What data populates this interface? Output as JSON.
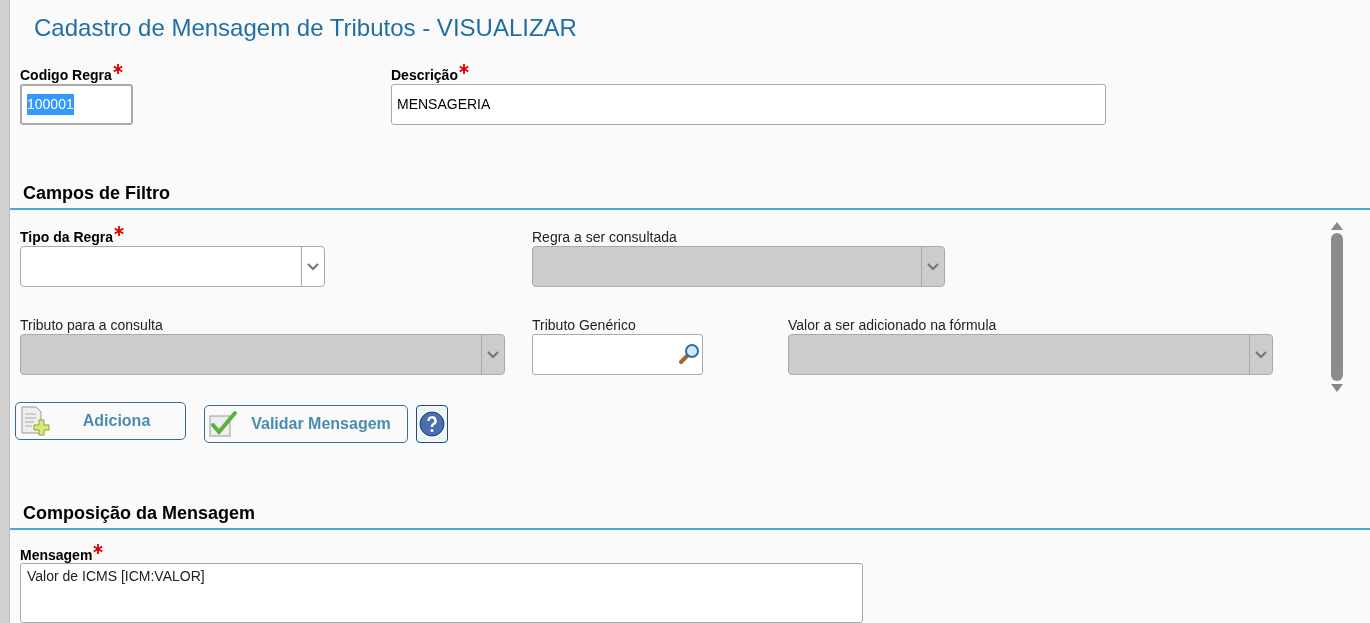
{
  "title": "Cadastro de Mensagem de Tributos - VISUALIZAR",
  "header_fields": [
    {
      "kind": "text",
      "label": "Codigo Regra",
      "required": true,
      "value": "100001",
      "selected": true,
      "disabled": false
    },
    {
      "kind": "text",
      "label": "Descrição",
      "required": true,
      "value": "MENSAGERIA",
      "selected": false,
      "disabled": false
    }
  ],
  "filter_section": {
    "title": "Campos de Filtro",
    "rows": [
      [
        {
          "kind": "select",
          "label": "Tipo da Regra",
          "required": true,
          "disabled": false
        },
        {
          "kind": "select",
          "label": "Regra a ser consultada",
          "required": false,
          "disabled": true
        }
      ],
      [
        {
          "kind": "select",
          "label": "Tributo para a consulta",
          "required": false,
          "disabled": true
        },
        {
          "kind": "search",
          "label": "Tributo Genérico",
          "required": false,
          "disabled": false
        },
        {
          "kind": "select",
          "label": "Valor a ser adicionado na fórmula",
          "required": false,
          "disabled": true
        }
      ]
    ],
    "buttons": [
      {
        "kind": "add",
        "label": "Adiciona"
      },
      {
        "kind": "validate",
        "label": "Validar Mensagem"
      },
      {
        "kind": "help"
      }
    ]
  },
  "message_section": {
    "title": "Composição da Mensagem",
    "field": {
      "kind": "textarea",
      "label": "Mensagem",
      "required": true,
      "value": "Valor de ICMS [ICM:VALOR]"
    }
  }
}
